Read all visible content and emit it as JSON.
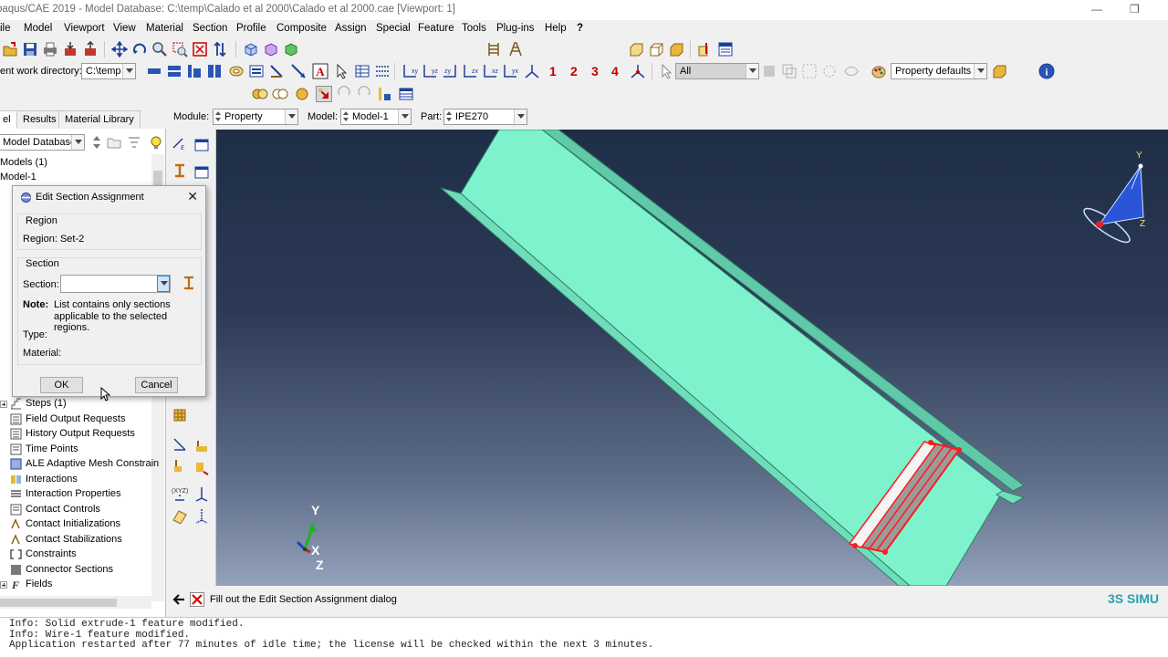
{
  "window": {
    "title": "baqus/CAE 2019 - Model Database: C:\\temp\\Calado et al 2000\\Calado et al 2000.cae [Viewport: 1]",
    "minimize": "—",
    "restore": "❐"
  },
  "menu": [
    "ile",
    "Model",
    "Viewport",
    "View",
    "Material",
    "Section",
    "Profile",
    "Composite",
    "Assign",
    "Special",
    "Feature",
    "Tools",
    "Plug-ins",
    "Help",
    "?"
  ],
  "toolbar2": {
    "workdir_label": "ent work directory:",
    "workdir_value": "C:\\temp",
    "numbers": [
      "1",
      "2",
      "3",
      "4"
    ],
    "selection_filter": "All",
    "render_style": "Property defaults"
  },
  "context": {
    "module_label": "Module:",
    "module_value": "Property",
    "model_label": "Model:",
    "model_value": "Model-1",
    "part_label": "Part:",
    "part_value": "IPE270"
  },
  "tabs": [
    "el",
    "Results",
    "Material Library"
  ],
  "tree": {
    "database_select": "Model Database",
    "top_items": [
      "Models (1)",
      "Model-1"
    ],
    "items": [
      "Steps (1)",
      "Field Output Requests",
      "History Output Requests",
      "Time Points",
      "ALE Adaptive Mesh Constrain",
      "Interactions",
      "Interaction Properties",
      "Contact Controls",
      "Contact Initializations",
      "Contact Stabilizations",
      "Constraints",
      "Connector Sections",
      "Fields"
    ]
  },
  "dialog": {
    "title": "Edit Section Assignment",
    "region_group": "Region",
    "region_text": "Region:  Set-2",
    "section_group": "Section",
    "section_label": "Section:",
    "section_value": "",
    "note_label": "Note:",
    "note_line1": "List contains only sections",
    "note_line2": "applicable to the selected regions.",
    "type_label": "Type:",
    "material_label": "Material:",
    "ok": "OK",
    "cancel": "Cancel"
  },
  "viewport": {
    "triad": {
      "x": "X",
      "y": "Y",
      "z": "Z"
    },
    "brand": "3S SIMU",
    "beam_color": "#7ef2cc",
    "selection_color": "#ff1a1a"
  },
  "prompt": {
    "text": "Fill out the Edit Section Assignment dialog"
  },
  "console": [
    "Info: Solid extrude-1 feature modified.",
    "Info: Wire-1 feature modified.",
    "Application restarted after 77 minutes of idle time; the license will be checked within the next 3 minutes."
  ]
}
